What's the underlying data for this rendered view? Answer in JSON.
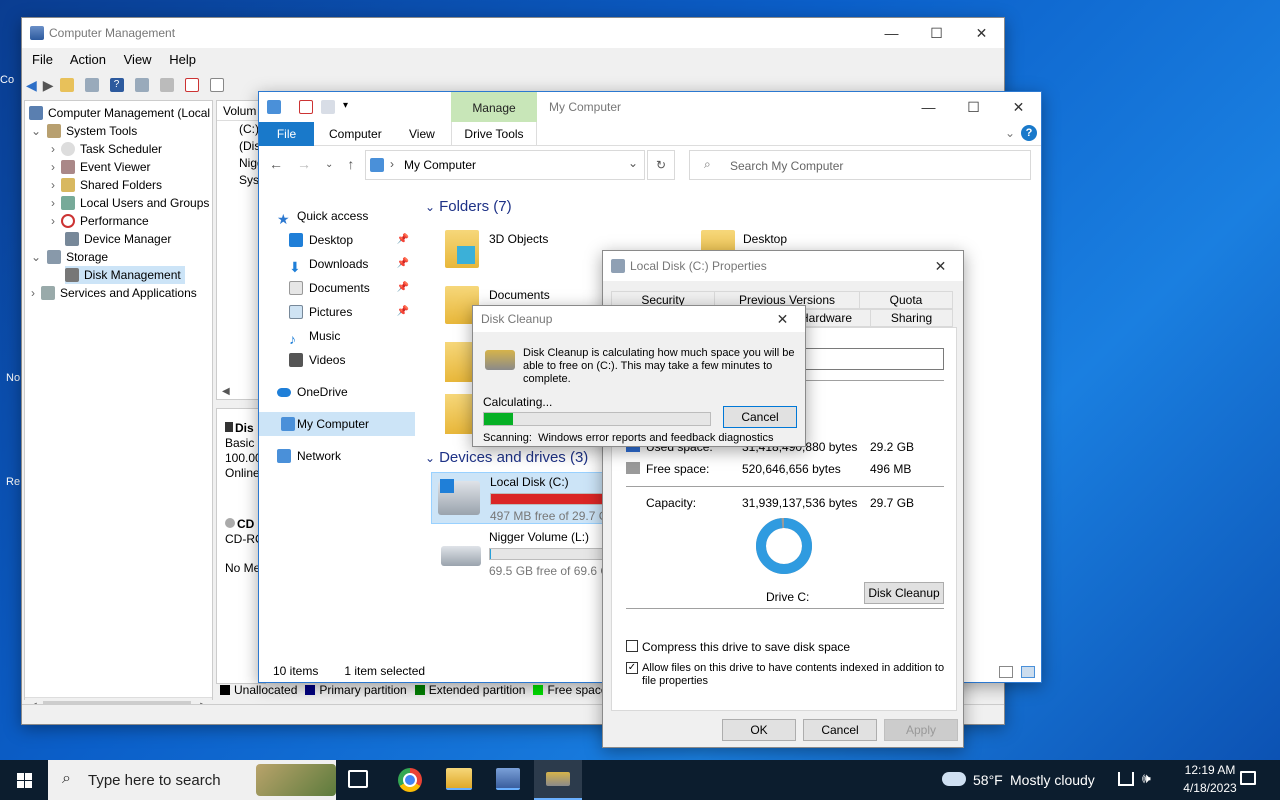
{
  "desktop": {
    "icons": [
      "Co",
      "No",
      "Re"
    ]
  },
  "cm": {
    "title": "Computer Management",
    "menu": [
      "File",
      "Action",
      "View",
      "Help"
    ],
    "tree": [
      {
        "label": "Computer Management (Local",
        "level": 0
      },
      {
        "label": "System Tools",
        "level": 1
      },
      {
        "label": "Task Scheduler",
        "level": 2
      },
      {
        "label": "Event Viewer",
        "level": 2
      },
      {
        "label": "Shared Folders",
        "level": 2
      },
      {
        "label": "Local Users and Groups",
        "level": 2
      },
      {
        "label": "Performance",
        "level": 2
      },
      {
        "label": "Device Manager",
        "level": 2
      },
      {
        "label": "Storage",
        "level": 1
      },
      {
        "label": "Disk Management",
        "level": 2
      },
      {
        "label": "Services and Applications",
        "level": 1
      }
    ],
    "volume_header": "Volum",
    "volumes": [
      "(C:)",
      "(Dis",
      "Nigg",
      "Syst"
    ],
    "disk0": {
      "name": "Dis",
      "type": "Basic",
      "size": "100.00",
      "status": "Online"
    },
    "cd0": {
      "name": "CD",
      "type": "CD-RO",
      "media": "No Me"
    },
    "legend": [
      {
        "label": "Unallocated",
        "color": "#000000"
      },
      {
        "label": "Primary partition",
        "color": "#000080"
      },
      {
        "label": "Extended partition",
        "color": "#008000"
      },
      {
        "label": "Free space",
        "color": "#00e000"
      }
    ]
  },
  "explorer": {
    "title": "My Computer",
    "manage_tab": "Manage",
    "ribbon_tabs": [
      "File",
      "Computer",
      "View",
      "Drive Tools"
    ],
    "address": "My Computer",
    "search_placeholder": "Search My Computer",
    "nav": [
      {
        "label": "Quick access",
        "pinned": false
      },
      {
        "label": "Desktop",
        "pinned": true
      },
      {
        "label": "Downloads",
        "pinned": true
      },
      {
        "label": "Documents",
        "pinned": true
      },
      {
        "label": "Pictures",
        "pinned": true
      },
      {
        "label": "Music",
        "pinned": false
      },
      {
        "label": "Videos",
        "pinned": false
      },
      {
        "label": "OneDrive",
        "pinned": false
      },
      {
        "label": "My Computer",
        "pinned": false
      },
      {
        "label": "Network",
        "pinned": false
      }
    ],
    "folders_header": "Folders (7)",
    "folders": [
      "3D Objects",
      "Desktop",
      "Documents"
    ],
    "drives_header": "Devices and drives (3)",
    "drives": [
      {
        "name": "Local Disk (C:)",
        "free": "497 MB free of 29.7 GB",
        "used_fraction": 0.983,
        "bar_color": "#da2626"
      },
      {
        "name": "Nigger Volume (L:)",
        "free": "69.5 GB free of 69.6 GB",
        "used_fraction": 0.01,
        "bar_color": "#26a0da"
      }
    ],
    "status_items": "10 items",
    "status_selected": "1 item selected"
  },
  "props": {
    "title": "Local Disk (C:) Properties",
    "tabs_row1": [
      "Security",
      "Previous Versions",
      "Quota"
    ],
    "tabs_row2": [
      "Hardware",
      "Sharing"
    ],
    "used": {
      "label": "Used space:",
      "bytes": "31,418,490,880 bytes",
      "size": "29.2 GB"
    },
    "free": {
      "label": "Free space:",
      "bytes": "520,646,656 bytes",
      "size": "496 MB"
    },
    "capacity": {
      "label": "Capacity:",
      "bytes": "31,939,137,536 bytes",
      "size": "29.7 GB"
    },
    "used_fraction": 0.984,
    "drive_label": "Drive C:",
    "disk_cleanup": "Disk Cleanup",
    "compress": "Compress this drive to save disk space",
    "compress_checked": false,
    "index_line1": "Allow files on this drive to have contents indexed in addition to",
    "index_line2": "file properties",
    "index_checked": true,
    "ok": "OK",
    "cancel": "Cancel",
    "apply": "Apply"
  },
  "cleanup": {
    "title": "Disk Cleanup",
    "message": "Disk Cleanup is calculating how much space you will be able to free on  (C:). This may take a few minutes to complete.",
    "calculating": "Calculating...",
    "progress": 0.13,
    "cancel": "Cancel",
    "scanning_label": "Scanning:",
    "scanning_item": "Windows error reports and feedback diagnostics"
  },
  "taskbar": {
    "search_placeholder": "Type here to search",
    "weather_temp": "58°F",
    "weather_desc": "Mostly cloudy",
    "time": "12:19 AM",
    "date": "4/18/2023"
  }
}
